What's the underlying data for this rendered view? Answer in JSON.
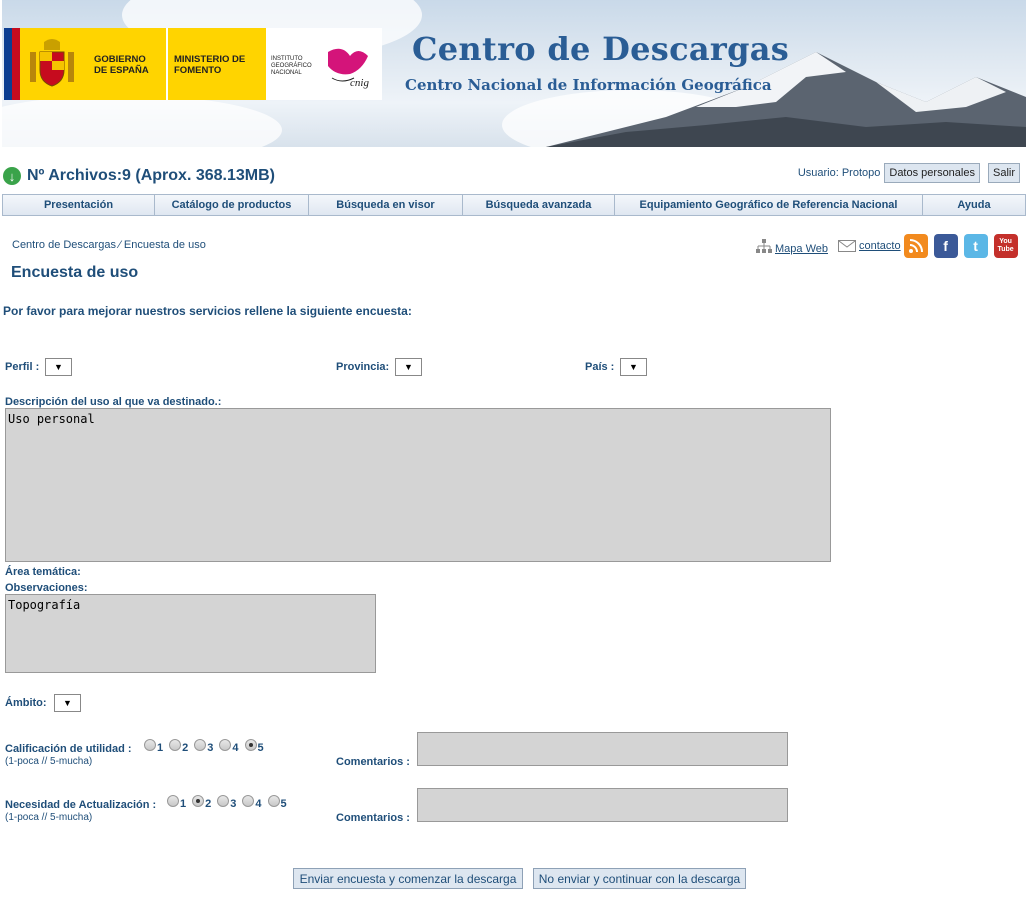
{
  "banner": {
    "gobierno": "GOBIERNO DE ESPAÑA",
    "ministerio": "MINISTERIO DE FOMENTO",
    "instituto": "INSTITUTO GEOGRÁFICO NACIONAL",
    "cnig": "cnig",
    "title": "Centro de Descargas",
    "subtitle": "Centro Nacional de Información Geográfica"
  },
  "header": {
    "files_summary": "Nº Archivos:9 (Aprox. 368.13MB)",
    "user_label": "Usuario: Protopo",
    "personal_data_button": "Datos personales",
    "exit_button": "Salir"
  },
  "nav": [
    {
      "label": "Presentación"
    },
    {
      "label": "Catálogo de productos"
    },
    {
      "label": "Búsqueda en visor"
    },
    {
      "label": "Búsqueda avanzada"
    },
    {
      "label": "Equipamiento Geográfico de Referencia Nacional"
    },
    {
      "label": "Ayuda"
    }
  ],
  "breadcrumb": "Centro de Descargas ⁄ Encuesta de uso",
  "links": {
    "sitemap": "Mapa Web",
    "contact": "contacto"
  },
  "social": {
    "facebook": "f",
    "twitter": "t",
    "youtube": "You Tube"
  },
  "page_title": "Encuesta de uso",
  "intro": "Por favor para mejorar nuestros servicios rellene la siguiente encuesta:",
  "form": {
    "perfil_label": "Perfil :",
    "provincia_label": "Provincia:",
    "pais_label": "País :",
    "select_arrow": "▼",
    "descripcion_label": "Descripción del uso al que va destinado.:",
    "descripcion_value": "Uso personal",
    "area_label": "Área temática:",
    "observaciones_label": "Observaciones:",
    "observaciones_value": "Topografía",
    "ambito_label": "Ámbito:",
    "utilidad_label": "Calificación de utilidad :",
    "utilidad_hint": "(1-poca // 5-mucha)",
    "utilidad_selected": 5,
    "actualizacion_label": "Necesidad de Actualización :",
    "actualizacion_hint": "(1-poca // 5-mucha)",
    "actualizacion_selected": 2,
    "ratings": [
      "1",
      "2",
      "3",
      "4",
      "5"
    ],
    "comentarios_label": "Comentarios :"
  },
  "buttons": {
    "send": "Enviar encuesta y comenzar la descarga",
    "skip": "No enviar y continuar con la descarga"
  }
}
